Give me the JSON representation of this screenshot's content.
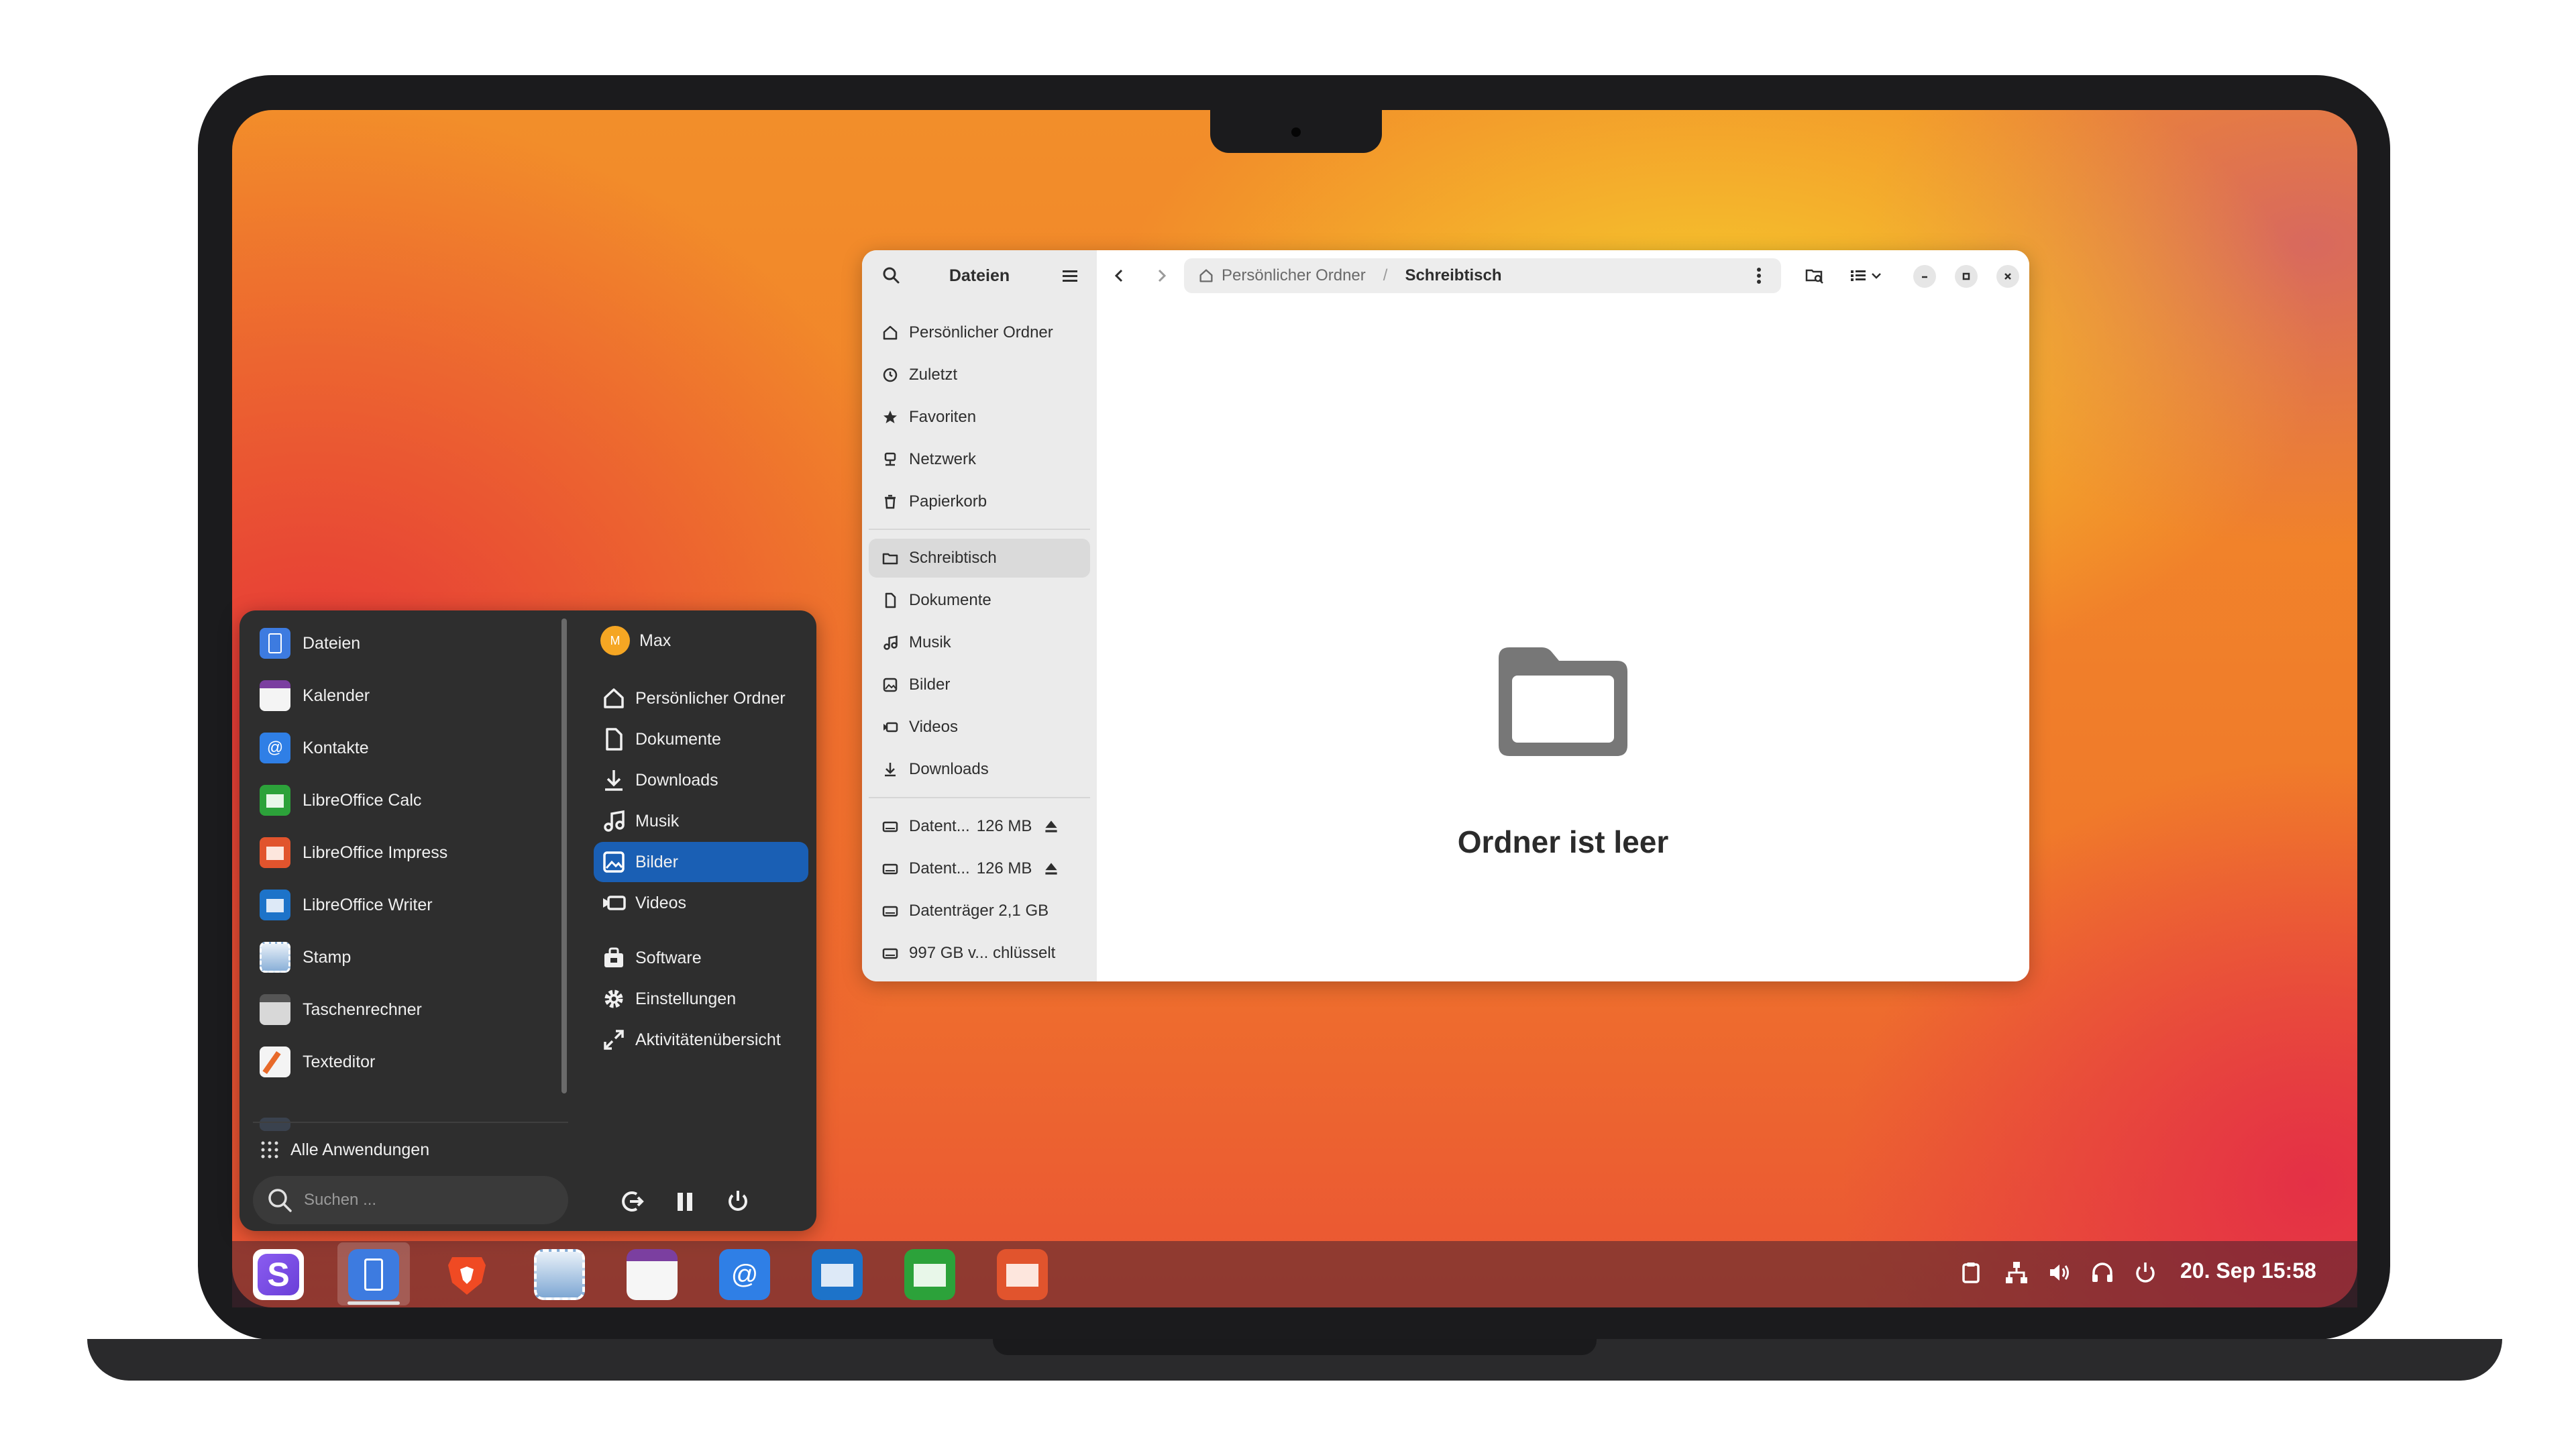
{
  "files_window": {
    "title": "Dateien",
    "breadcrumb": {
      "home": "Persönlicher Ordner",
      "current": "Schreibtisch"
    },
    "empty_message": "Ordner ist leer",
    "sidebar_places": [
      "Persönlicher Ordner",
      "Zuletzt",
      "Favoriten",
      "Netzwerk",
      "Papierkorb"
    ],
    "sidebar_folders": [
      "Schreibtisch",
      "Dokumente",
      "Musik",
      "Bilder",
      "Videos",
      "Downloads"
    ],
    "sidebar_devices": [
      {
        "name": "Datent...",
        "size": "126 MB"
      },
      {
        "name": "Datent...",
        "size": "126 MB"
      },
      {
        "name": "Datenträger 2,1 GB",
        "size": ""
      },
      {
        "name": "997 GB v... chlüsselt",
        "size": ""
      }
    ]
  },
  "start_menu": {
    "apps": [
      "Dateien",
      "Kalender",
      "Kontakte",
      "LibreOffice Calc",
      "LibreOffice Impress",
      "LibreOffice Writer",
      "Stamp",
      "Taschenrechner",
      "Texteditor"
    ],
    "all_apps_label": "Alle Anwendungen",
    "search_placeholder": "Suchen ...",
    "user": {
      "name": "Max",
      "initial": "M"
    },
    "places": [
      "Persönlicher Ordner",
      "Dokumente",
      "Downloads",
      "Musik",
      "Bilder",
      "Videos"
    ],
    "system": [
      "Software",
      "Einstellungen",
      "Aktivitätenübersicht"
    ]
  },
  "taskbar": {
    "clock": "20. Sep  15:58"
  },
  "colors": {
    "accent": "#1a5fb4",
    "menu_bg": "#2e2e2e",
    "sidebar_bg": "#ebebeb"
  }
}
